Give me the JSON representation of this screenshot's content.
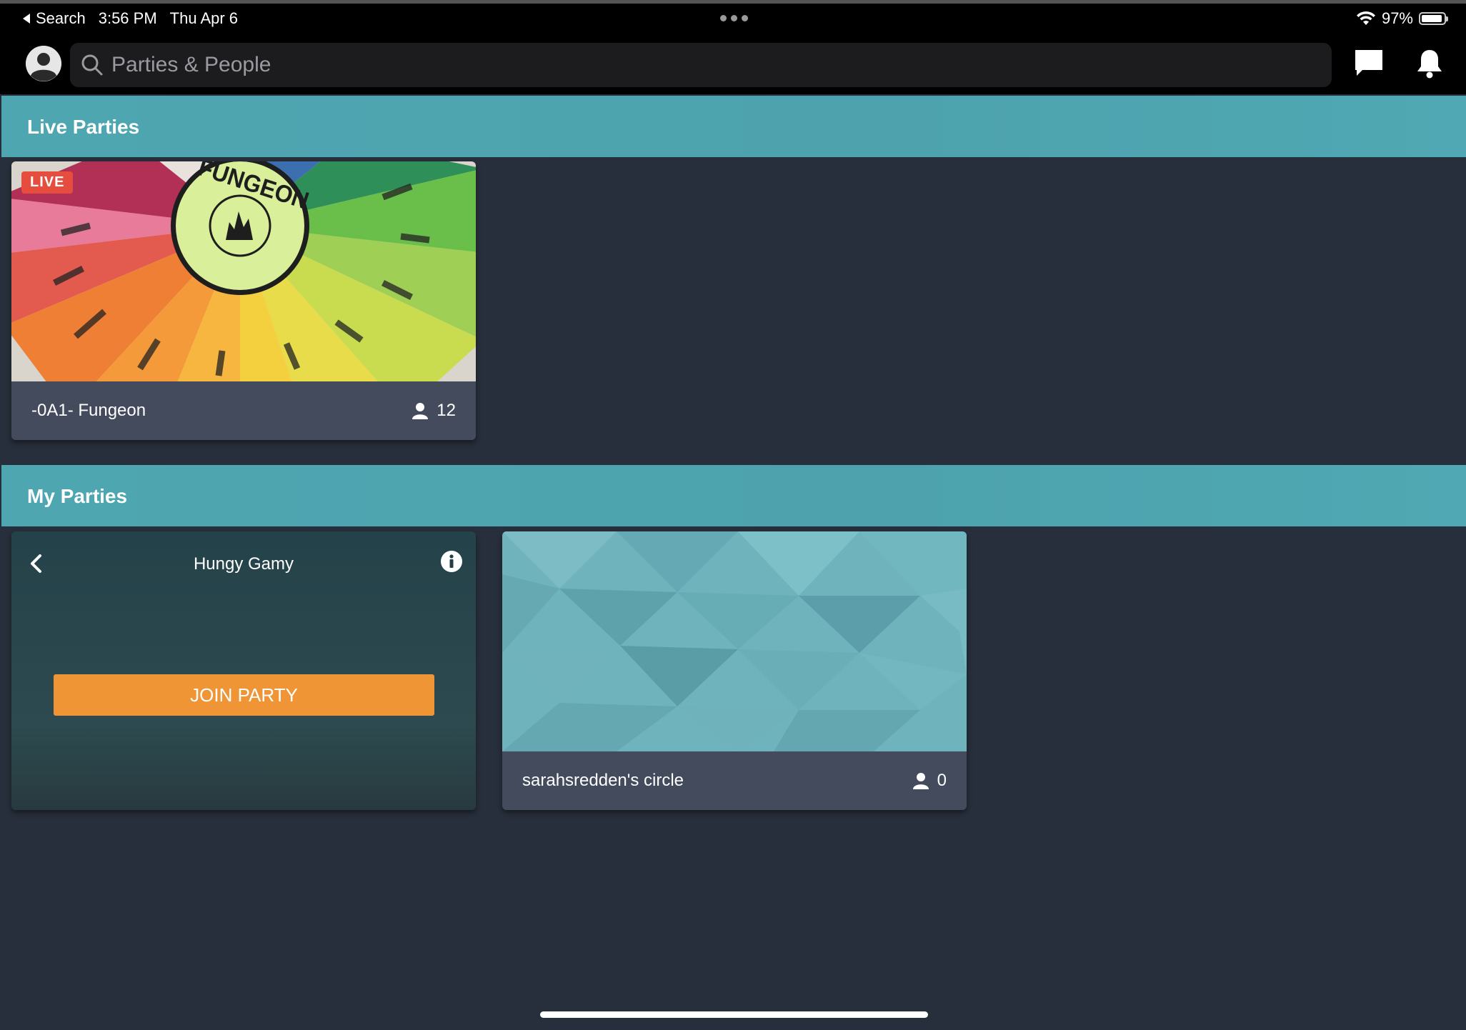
{
  "status_bar": {
    "back_label": "Search",
    "time": "3:56 PM",
    "date": "Thu Apr 6",
    "battery": "97%"
  },
  "header": {
    "search_placeholder": "Parties & People"
  },
  "sections": {
    "live": {
      "title": "Live Parties"
    },
    "mine": {
      "title": "My Parties"
    }
  },
  "live_parties": [
    {
      "badge": "LIVE",
      "name": "-0A1- Fungeon",
      "members": "12",
      "logo_text": "FUNGEON"
    }
  ],
  "my_parties": {
    "hungy": {
      "title": "Hungy Gamy",
      "join_label": "JOIN PARTY"
    },
    "circle": {
      "name": "sarahsredden's circle",
      "members": "0"
    }
  },
  "colors": {
    "background": "#282f3c",
    "section_bar": "#4ea6b1",
    "card_footer": "#434b5c",
    "join_button": "#f09536",
    "live_badge": "#e64d3f"
  }
}
